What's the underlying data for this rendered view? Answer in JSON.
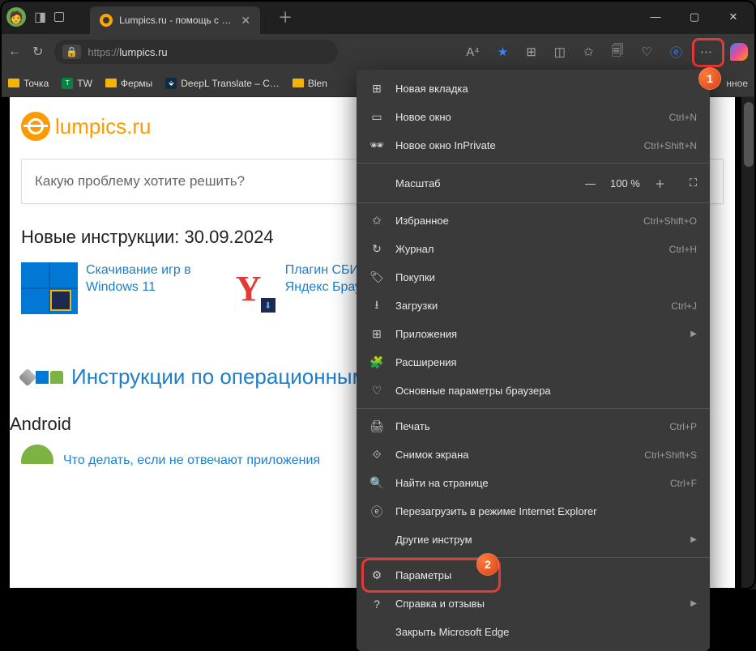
{
  "titlebar": {
    "tab_title": "Lumpics.ru - помощь с компьюте",
    "win_min": "—",
    "win_max": "▢",
    "win_close": "✕"
  },
  "addressbar": {
    "proto": "https://",
    "host": "lumpics.ru",
    "reading_aa": "A⁴"
  },
  "bookmarks": {
    "b1": "Точка",
    "b2": "TW",
    "b3": "Фермы",
    "b4": "DeepL Translate – С…",
    "b5": "Blen",
    "right": "нное"
  },
  "page": {
    "site_name": "lumpics.ru",
    "search_placeholder": "Какую проблему хотите решить?",
    "new_instructions": "Новые инструкции: 30.09.2024",
    "article1_l1": "Скачивание игр в",
    "article1_l2": "Windows 11",
    "article2_l1": "Плагин СБИС д",
    "article2_l2": "Яндекс Браузер",
    "os_section": "Инструкции по операционным",
    "android_title": "Android",
    "android_item": "Что делать, если не отвечают приложения"
  },
  "menu": {
    "new_tab": "Новая вкладка",
    "new_window": "Новое окно",
    "new_window_sc": "Ctrl+N",
    "inprivate": "Новое окно InPrivate",
    "inprivate_sc": "Ctrl+Shift+N",
    "zoom_label": "Масштаб",
    "zoom_value": "100 %",
    "favorites": "Избранное",
    "favorites_sc": "Ctrl+Shift+O",
    "history": "Журнал",
    "history_sc": "Ctrl+H",
    "shopping": "Покупки",
    "downloads": "Загрузки",
    "downloads_sc": "Ctrl+J",
    "apps": "Приложения",
    "extensions": "Расширения",
    "essentials": "Основные параметры браузера",
    "print": "Печать",
    "print_sc": "Ctrl+P",
    "screenshot": "Снимок экрана",
    "screenshot_sc": "Ctrl+Shift+S",
    "find": "Найти на странице",
    "find_sc": "Ctrl+F",
    "ie_mode": "Перезагрузить в режиме Internet Explorer",
    "more_tools": "Другие инструм",
    "settings": "Параметры",
    "help": "Справка и отзывы",
    "close_edge": "Закрыть Microsoft Edge"
  },
  "callouts": {
    "c1": "1",
    "c2": "2"
  }
}
